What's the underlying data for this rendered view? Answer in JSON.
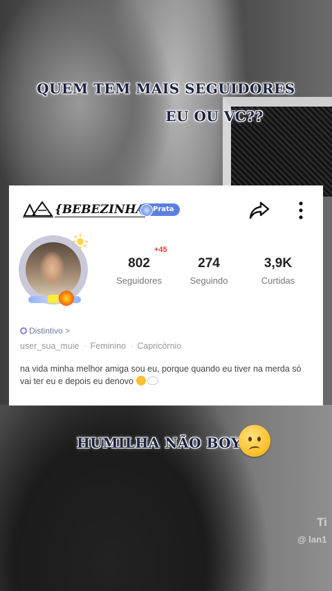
{
  "overlay": {
    "line1": "QUEM TEM MAIS SEGUIDORES",
    "line2": "EU OU VC??",
    "line3": "HUMILHA NÃO BOY"
  },
  "watermark": {
    "brand": "Ti",
    "handle": "@ lan1"
  },
  "profile": {
    "logo_icon": "ab-logo-icon",
    "username": "{BEBEZINHA",
    "badge_label": "Prata",
    "share_icon": "share-icon",
    "more_icon": "more-vertical-icon",
    "stats": [
      {
        "value": "802",
        "label": "Seguidores",
        "delta": "+45"
      },
      {
        "value": "274",
        "label": "Seguindo"
      },
      {
        "value": "3,9K",
        "label": "Curtidas"
      }
    ],
    "distintivo": "Distintivo >",
    "meta": [
      "user_sua_muie",
      "Feminino",
      "Capricórnio"
    ],
    "bio": "na vida minha melhor amiga sou eu, porque quando eu tiver na merda só vai ter eu e depois eu denovo"
  },
  "colors": {
    "badge": "#5b7fe0",
    "delta": "#e53935",
    "overlay_text": "#1c2240"
  }
}
